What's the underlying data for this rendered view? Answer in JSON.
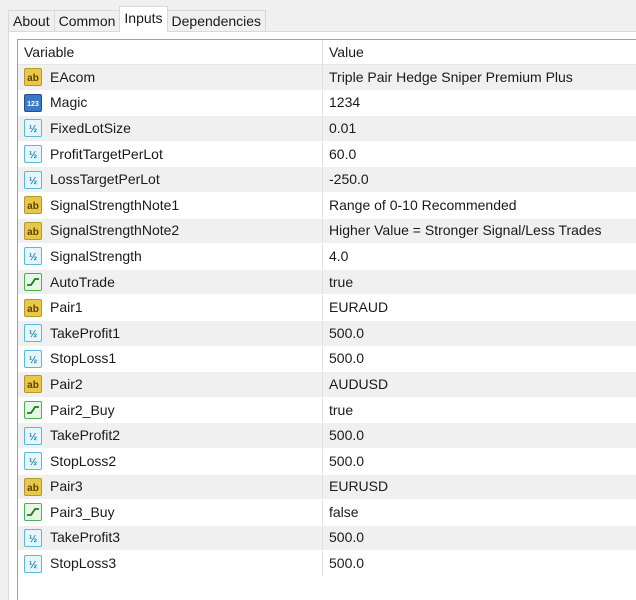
{
  "tabs": [
    {
      "label": "About",
      "active": false
    },
    {
      "label": "Common",
      "active": false
    },
    {
      "label": "Inputs",
      "active": true
    },
    {
      "label": "Dependencies",
      "active": false
    }
  ],
  "table": {
    "headers": {
      "variable": "Variable",
      "value": "Value"
    },
    "rows": [
      {
        "type": "string",
        "icon": "string-ab-icon",
        "name": "EAcom",
        "value": "Triple Pair Hedge Sniper Premium Plus"
      },
      {
        "type": "integer",
        "icon": "integer-123-icon",
        "name": "Magic",
        "value": "1234"
      },
      {
        "type": "double",
        "icon": "double-fraction-icon",
        "name": "FixedLotSize",
        "value": "0.01"
      },
      {
        "type": "double",
        "icon": "double-fraction-icon",
        "name": "ProfitTargetPerLot",
        "value": "60.0"
      },
      {
        "type": "double",
        "icon": "double-fraction-icon",
        "name": "LossTargetPerLot",
        "value": "-250.0"
      },
      {
        "type": "string",
        "icon": "string-ab-icon",
        "name": "SignalStrengthNote1",
        "value": "Range of 0-10 Recommended"
      },
      {
        "type": "string",
        "icon": "string-ab-icon",
        "name": "SignalStrengthNote2",
        "value": "Higher Value = Stronger Signal/Less Trades"
      },
      {
        "type": "double",
        "icon": "double-fraction-icon",
        "name": "SignalStrength",
        "value": "4.0"
      },
      {
        "type": "bool",
        "icon": "boolean-toggle-icon",
        "name": "AutoTrade",
        "value": "true"
      },
      {
        "type": "string",
        "icon": "string-ab-icon",
        "name": "Pair1",
        "value": "EURAUD"
      },
      {
        "type": "double",
        "icon": "double-fraction-icon",
        "name": "TakeProfit1",
        "value": "500.0"
      },
      {
        "type": "double",
        "icon": "double-fraction-icon",
        "name": "StopLoss1",
        "value": "500.0"
      },
      {
        "type": "string",
        "icon": "string-ab-icon",
        "name": "Pair2",
        "value": "AUDUSD"
      },
      {
        "type": "bool",
        "icon": "boolean-toggle-icon",
        "name": "Pair2_Buy",
        "value": "true"
      },
      {
        "type": "double",
        "icon": "double-fraction-icon",
        "name": "TakeProfit2",
        "value": "500.0"
      },
      {
        "type": "double",
        "icon": "double-fraction-icon",
        "name": "StopLoss2",
        "value": "500.0"
      },
      {
        "type": "string",
        "icon": "string-ab-icon",
        "name": "Pair3",
        "value": "EURUSD"
      },
      {
        "type": "bool",
        "icon": "boolean-toggle-icon",
        "name": "Pair3_Buy",
        "value": "false"
      },
      {
        "type": "double",
        "icon": "double-fraction-icon",
        "name": "TakeProfit3",
        "value": "500.0"
      },
      {
        "type": "double",
        "icon": "double-fraction-icon",
        "name": "StopLoss3",
        "value": "500.0"
      }
    ]
  },
  "colors": {
    "string_icon": "#e8c84a",
    "integer_icon": "#3a78c8",
    "double_icon": "#5ab8d8",
    "bool_icon": "#4caf50",
    "row_alt": "#f0f0f0"
  }
}
